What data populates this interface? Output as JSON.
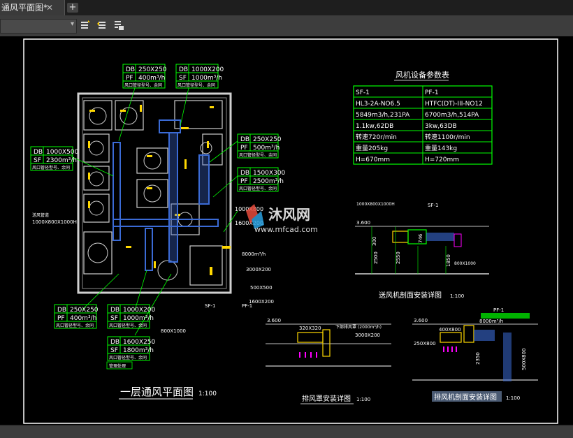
{
  "tab": {
    "label": "通风平面图*",
    "close": "✕",
    "add": "+"
  },
  "toolbar": {
    "layer_combo": "",
    "combo_arrow": "▾"
  },
  "colors": {
    "frame": "#ffffff",
    "table": "#00ff00",
    "duct": "#3b6bd6",
    "wall": "#d0d0d0",
    "text": "#ffffff",
    "label_box": "#00ff00"
  },
  "plan": {
    "title": "一层通风平面图",
    "scale": "1:100",
    "callouts": [
      {
        "tag1": "DB",
        "val1": "250X250",
        "tag2": "PF",
        "val2": "400m³/h",
        "note": "风口管径型号、余同"
      },
      {
        "tag1": "DB",
        "val1": "1000X200",
        "tag2": "SF",
        "val2": "1000m³/h",
        "note": "风口管径型号、余同"
      },
      {
        "tag1": "DB",
        "val1": "1000X500",
        "tag2": "SF",
        "val2": "2300m³/h",
        "note": "风口管径型号、余同"
      },
      {
        "tag1": "DB",
        "val1": "250X250",
        "tag2": "PF",
        "val2": "500m³/h",
        "note": "风口管径型号、余同"
      },
      {
        "tag1": "DB",
        "val1": "1500X300",
        "tag2": "PF",
        "val2": "2500m³/h",
        "note": "风口管径型号、余同"
      },
      {
        "tag1": "DB",
        "val1": "250X250",
        "tag2": "PF",
        "val2": "400m³/h",
        "note": "风口管径型号、余同"
      },
      {
        "tag1": "DB",
        "val1": "1000X200",
        "tag2": "SF",
        "val2": "1000m³/h",
        "note": "风口管径型号、余同"
      },
      {
        "tag1": "DB",
        "val1": "1600X250",
        "tag2": "SF",
        "val2": "1800m³/h",
        "note": "风口管径型号、余同"
      }
    ],
    "labels": {
      "left_duct": "1000X800X1000H",
      "left_duct_note": "送风管道",
      "mid1": "1000X800",
      "mid2": "1600X200",
      "mid3": "500X500",
      "mid4": "3000X200",
      "mid5": "8000m³/h",
      "bottom1": "800X1000",
      "bottom2": "1600X200",
      "sf1": "SF-1",
      "pf1": "PF-1",
      "defer_note": "管理处理"
    }
  },
  "equip_table": {
    "title": "风机设备参数表",
    "rows": [
      [
        "SF-1",
        "PF-1"
      ],
      [
        "HL3-2A-NO6.5",
        "HTFC(DT)-III-NO12"
      ],
      [
        "5849m3/h,231PA",
        "6700m3/h,514PA"
      ],
      [
        "1.1kw,62DB",
        "3kw,63DB"
      ],
      [
        "转速720r/min",
        "转速1100r/min"
      ],
      [
        "重量205kg",
        "重量143kg"
      ],
      [
        "H=670mm",
        "H=720mm"
      ]
    ]
  },
  "detail_supply": {
    "title": "送风机剖面安装详图",
    "scale": "1:100",
    "labels": {
      "size": "1000X800X1000H",
      "elev": "3.600",
      "sf1": "SF-1",
      "dim1": "2500",
      "dim2": "2550",
      "dim3": "1850",
      "out": "800X1000",
      "h1": "300",
      "h2": "746"
    }
  },
  "detail_exhaust_hood": {
    "title": "排风罩安装详图",
    "scale": "1:100",
    "labels": {
      "elev": "3.600",
      "size1": "320X320",
      "size2": "3000X200",
      "flow": "下部排风罩 (2000m³/h)"
    }
  },
  "detail_exhaust_fan": {
    "title": "排风机剖面安装详图",
    "scale": "1:100",
    "labels": {
      "elev": "3.600",
      "pf1": "PF-1",
      "size1": "400X800",
      "size2": "250X800",
      "flow": "8000m³/h",
      "dim": "2350",
      "out": "500X800"
    }
  },
  "watermark": {
    "brand": "沐风网",
    "url": "www.mfcad.com"
  }
}
